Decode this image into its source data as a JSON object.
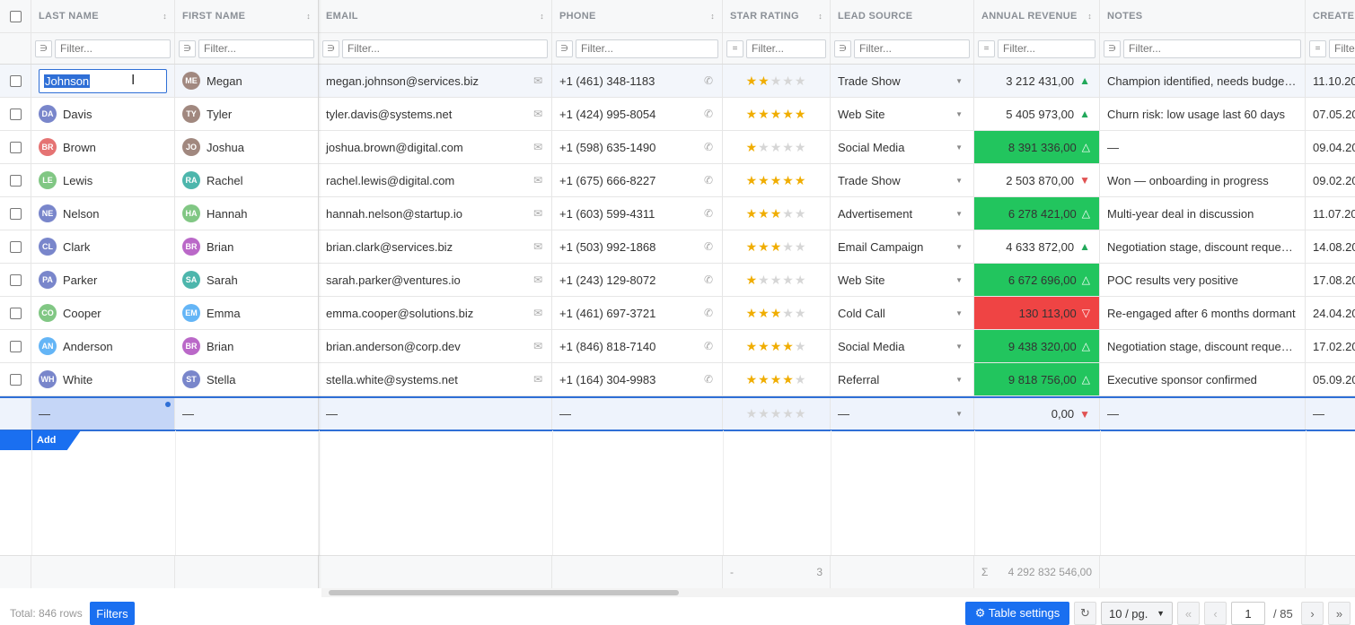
{
  "columns": [
    {
      "label": "LAST NAME",
      "sortable": true
    },
    {
      "label": "FIRST NAME",
      "sortable": true
    },
    {
      "label": "EMAIL",
      "sortable": true
    },
    {
      "label": "PHONE",
      "sortable": true
    },
    {
      "label": "STAR RATING",
      "sortable": true
    },
    {
      "label": "LEAD SOURCE",
      "sortable": false
    },
    {
      "label": "ANNUAL REVENUE",
      "sortable": true
    },
    {
      "label": "NOTES",
      "sortable": false
    },
    {
      "label": "CREATE",
      "sortable": false
    }
  ],
  "filters": [
    {
      "op": "∋",
      "placeholder": "Filter..."
    },
    {
      "op": "∋",
      "placeholder": "Filter..."
    },
    {
      "op": "∋",
      "placeholder": "Filter..."
    },
    {
      "op": "∋",
      "placeholder": "Filter..."
    },
    {
      "op": "=",
      "placeholder": "Filter..."
    },
    {
      "op": "∋",
      "placeholder": "Filter..."
    },
    {
      "op": "=",
      "placeholder": "Filter..."
    },
    {
      "op": "∋",
      "placeholder": "Filter..."
    },
    {
      "op": "=",
      "placeholder": "Filte"
    }
  ],
  "rows": [
    {
      "last": "Johnson",
      "last_initials": "",
      "last_color": "",
      "first": "Megan",
      "first_initials": "ME",
      "first_color": "#a1887f",
      "email": "megan.johnson@services.biz",
      "phone": "+1 (461) 348-1183",
      "stars": 2,
      "source": "Trade Show",
      "revenue": "3 212 431,00",
      "trend": "up",
      "highlight": "none",
      "notes": "Champion identified, needs budget approval",
      "created": "11.10.20"
    },
    {
      "last": "Davis",
      "last_initials": "DA",
      "last_color": "#7986cb",
      "first": "Tyler",
      "first_initials": "TY",
      "first_color": "#a1887f",
      "email": "tyler.davis@systems.net",
      "phone": "+1 (424) 995-8054",
      "stars": 5,
      "source": "Web Site",
      "revenue": "5 405 973,00",
      "trend": "up",
      "highlight": "none",
      "notes": "Churn risk: low usage last 60 days",
      "created": "07.05.20"
    },
    {
      "last": "Brown",
      "last_initials": "BR",
      "last_color": "#e57373",
      "first": "Joshua",
      "first_initials": "JO",
      "first_color": "#a1887f",
      "email": "joshua.brown@digital.com",
      "phone": "+1 (598) 635-1490",
      "stars": 1,
      "source": "Social Media",
      "revenue": "8 391 336,00",
      "trend": "up",
      "highlight": "green",
      "notes": "—",
      "created": "09.04.20"
    },
    {
      "last": "Lewis",
      "last_initials": "LE",
      "last_color": "#81c784",
      "first": "Rachel",
      "first_initials": "RA",
      "first_color": "#4db6ac",
      "email": "rachel.lewis@digital.com",
      "phone": "+1 (675) 666-8227",
      "stars": 5,
      "source": "Trade Show",
      "revenue": "2 503 870,00",
      "trend": "down",
      "highlight": "none",
      "notes": "Won — onboarding in progress",
      "created": "09.02.20"
    },
    {
      "last": "Nelson",
      "last_initials": "NE",
      "last_color": "#7986cb",
      "first": "Hannah",
      "first_initials": "HA",
      "first_color": "#81c784",
      "email": "hannah.nelson@startup.io",
      "phone": "+1 (603) 599-4311",
      "stars": 3,
      "source": "Advertisement",
      "revenue": "6 278 421,00",
      "trend": "up",
      "highlight": "green",
      "notes": "Multi-year deal in discussion",
      "created": "11.07.20"
    },
    {
      "last": "Clark",
      "last_initials": "CL",
      "last_color": "#7986cb",
      "first": "Brian",
      "first_initials": "BR",
      "first_color": "#ba68c8",
      "email": "brian.clark@services.biz",
      "phone": "+1 (503) 992-1868",
      "stars": 3,
      "source": "Email Campaign",
      "revenue": "4 633 872,00",
      "trend": "up",
      "highlight": "none",
      "notes": "Negotiation stage, discount requested",
      "created": "14.08.20"
    },
    {
      "last": "Parker",
      "last_initials": "PA",
      "last_color": "#7986cb",
      "first": "Sarah",
      "first_initials": "SA",
      "first_color": "#4db6ac",
      "email": "sarah.parker@ventures.io",
      "phone": "+1 (243) 129-8072",
      "stars": 1,
      "source": "Web Site",
      "revenue": "6 672 696,00",
      "trend": "up",
      "highlight": "green",
      "notes": "POC results very positive",
      "created": "17.08.20"
    },
    {
      "last": "Cooper",
      "last_initials": "CO",
      "last_color": "#81c784",
      "first": "Emma",
      "first_initials": "EM",
      "first_color": "#64b5f6",
      "email": "emma.cooper@solutions.biz",
      "phone": "+1 (461) 697-3721",
      "stars": 3,
      "source": "Cold Call",
      "revenue": "130 113,00",
      "trend": "down",
      "highlight": "red",
      "notes": "Re-engaged after 6 months dormant",
      "created": "24.04.20"
    },
    {
      "last": "Anderson",
      "last_initials": "AN",
      "last_color": "#64b5f6",
      "first": "Brian",
      "first_initials": "BR",
      "first_color": "#ba68c8",
      "email": "brian.anderson@corp.dev",
      "phone": "+1 (846) 818-7140",
      "stars": 4,
      "source": "Social Media",
      "revenue": "9 438 320,00",
      "trend": "up",
      "highlight": "green",
      "notes": "Negotiation stage, discount requested",
      "created": "17.02.20"
    },
    {
      "last": "White",
      "last_initials": "WH",
      "last_color": "#7986cb",
      "first": "Stella",
      "first_initials": "ST",
      "first_color": "#7986cb",
      "email": "stella.white@systems.net",
      "phone": "+1 (164) 304-9983",
      "stars": 4,
      "source": "Referral",
      "revenue": "9 818 756,00",
      "trend": "up",
      "highlight": "green",
      "notes": "Executive sponsor confirmed",
      "created": "05.09.20"
    }
  ],
  "new_row": {
    "last": "—",
    "first": "—",
    "email": "—",
    "phone": "—",
    "stars": 0,
    "source": "—",
    "revenue": "0,00",
    "trend": "down",
    "notes": "—",
    "created": "—"
  },
  "add_label": "Add",
  "summary": {
    "stars_agg": "-",
    "stars_value": "3",
    "revenue_agg": "Σ",
    "revenue_value": "4 292 832 546,00"
  },
  "status": {
    "total": "Total: 846 rows",
    "filters_label": "Filters",
    "settings_label": "⚙ Table settings",
    "refresh": "↻",
    "page_size": "10 / pg.",
    "first": "«",
    "prev": "‹",
    "page": "1",
    "page_total": "/ 85",
    "next": "›",
    "last": "»"
  },
  "colors": {
    "accent": "#1a6ff0",
    "green_cell": "#22c55e",
    "red_cell": "#ef4444",
    "up_arrow": "#22a85a",
    "down_arrow": "#e05252",
    "star": "#f0ad00"
  }
}
